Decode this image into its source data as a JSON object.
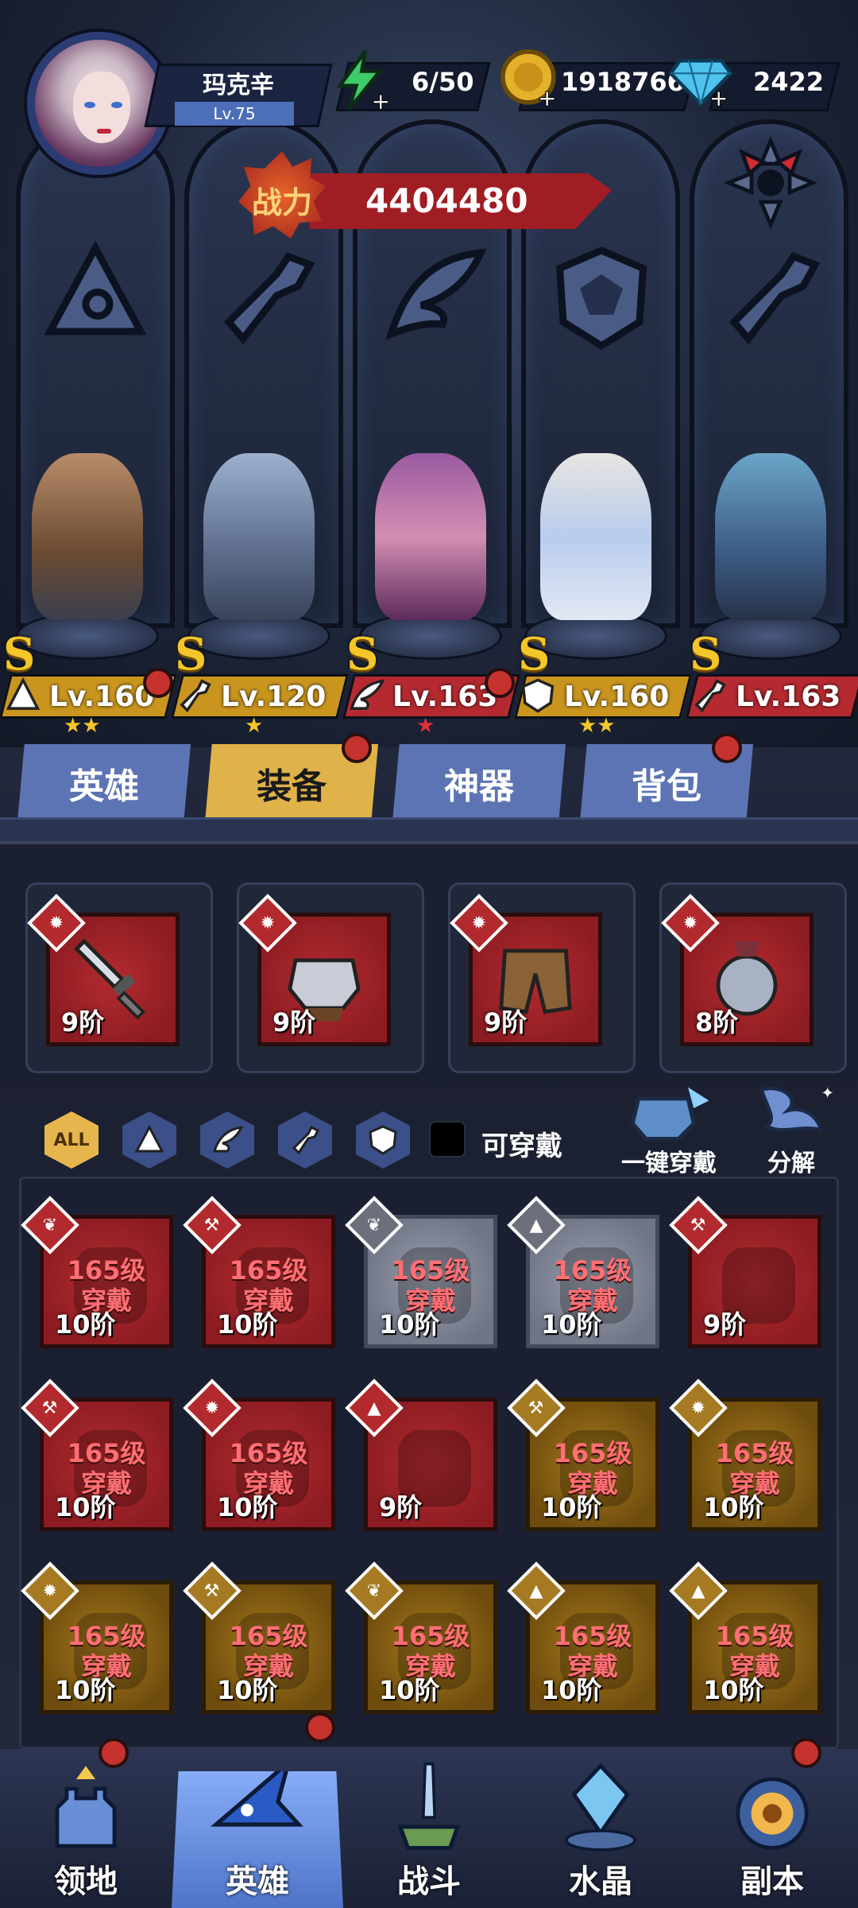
{
  "player": {
    "name": "玛克辛",
    "level": "Lv.75"
  },
  "resources": {
    "energy": "6/50",
    "gold": "1918766",
    "gems": "2422"
  },
  "power": {
    "label": "战力",
    "value": "4404480"
  },
  "heroes": [
    {
      "grade": "S",
      "level": "Lv.160",
      "stars": "★★",
      "class_icon": "hat-icon",
      "plate": "gold",
      "alert": true
    },
    {
      "grade": "S",
      "level": "Lv.120",
      "stars": "★",
      "class_icon": "wrench-icon",
      "plate": "gold",
      "alert": false
    },
    {
      "grade": "S",
      "level": "Lv.163",
      "stars": "★",
      "class_icon": "wing-icon",
      "plate": "red",
      "alert": true
    },
    {
      "grade": "S",
      "level": "Lv.160",
      "stars": "★★",
      "class_icon": "crest-icon",
      "plate": "gold",
      "alert": false
    },
    {
      "grade": "S",
      "level": "Lv.163",
      "stars": "",
      "class_icon": "wrench-icon",
      "plate": "red",
      "alert": false
    }
  ],
  "tabs": [
    {
      "label": "英雄",
      "active": false,
      "alert": false
    },
    {
      "label": "装备",
      "active": true,
      "alert": true
    },
    {
      "label": "神器",
      "active": false,
      "alert": false
    },
    {
      "label": "背包",
      "active": false,
      "alert": true
    }
  ],
  "equipped": [
    {
      "grade": "9阶",
      "item": "sword"
    },
    {
      "grade": "9阶",
      "item": "armor"
    },
    {
      "grade": "9阶",
      "item": "pants"
    },
    {
      "grade": "8阶",
      "item": "amulet"
    }
  ],
  "filters": {
    "all": "ALL",
    "wearable_label": "可穿戴",
    "auto_equip": "一键穿戴",
    "dismantle": "分解"
  },
  "inventory": [
    {
      "req": "165级",
      "wear": "穿戴",
      "grade": "10阶",
      "rarity": "red",
      "icon": "wing"
    },
    {
      "req": "165级",
      "wear": "穿戴",
      "grade": "10阶",
      "rarity": "red",
      "icon": "wrench"
    },
    {
      "req": "165级",
      "wear": "穿戴",
      "grade": "10阶",
      "rarity": "gray",
      "icon": "wing"
    },
    {
      "req": "165级",
      "wear": "穿戴",
      "grade": "10阶",
      "rarity": "gray",
      "icon": "hat"
    },
    {
      "req": "",
      "wear": "",
      "grade": "9阶",
      "rarity": "red",
      "icon": "wrench"
    },
    {
      "req": "165级",
      "wear": "穿戴",
      "grade": "10阶",
      "rarity": "red",
      "icon": "wrench"
    },
    {
      "req": "165级",
      "wear": "穿戴",
      "grade": "10阶",
      "rarity": "red",
      "icon": "crest"
    },
    {
      "req": "",
      "wear": "",
      "grade": "9阶",
      "rarity": "red",
      "icon": "hat"
    },
    {
      "req": "165级",
      "wear": "穿戴",
      "grade": "10阶",
      "rarity": "gold",
      "icon": "wrench"
    },
    {
      "req": "165级",
      "wear": "穿戴",
      "grade": "10阶",
      "rarity": "gold",
      "icon": "crest"
    },
    {
      "req": "165级",
      "wear": "穿戴",
      "grade": "10阶",
      "rarity": "gold",
      "icon": "crest"
    },
    {
      "req": "165级",
      "wear": "穿戴",
      "grade": "10阶",
      "rarity": "gold",
      "icon": "wrench"
    },
    {
      "req": "165级",
      "wear": "穿戴",
      "grade": "10阶",
      "rarity": "gold",
      "icon": "wing"
    },
    {
      "req": "165级",
      "wear": "穿戴",
      "grade": "10阶",
      "rarity": "gold",
      "icon": "hat"
    },
    {
      "req": "165级",
      "wear": "穿戴",
      "grade": "10阶",
      "rarity": "gold",
      "icon": "hat"
    }
  ],
  "nav": [
    {
      "label": "领地",
      "active": false,
      "alert": true
    },
    {
      "label": "英雄",
      "active": true,
      "alert": true
    },
    {
      "label": "战斗",
      "active": false,
      "alert": false
    },
    {
      "label": "水晶",
      "active": false,
      "alert": false
    },
    {
      "label": "副本",
      "active": false,
      "alert": true
    }
  ],
  "colors": {
    "red_item": "#a3252b",
    "gold_item": "#8e6414",
    "gray_item": "#878c9c",
    "tab_active": "#e0b24a",
    "tab_idle": "#5d74b4",
    "alert": "#c6322d"
  }
}
